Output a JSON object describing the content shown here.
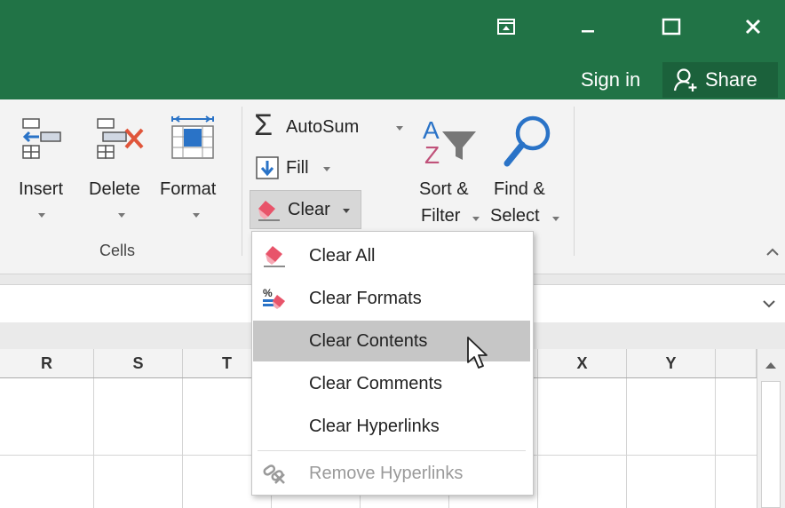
{
  "title_bar": {
    "window_buttons": [
      "ribbon-display-options",
      "minimize",
      "maximize",
      "close"
    ],
    "sign_in": "Sign in",
    "share": "Share"
  },
  "ribbon": {
    "cells_group": {
      "label": "Cells",
      "insert": "Insert",
      "delete": "Delete",
      "format": "Format"
    },
    "editing_group": {
      "autosum": "AutoSum",
      "fill": "Fill",
      "clear": "Clear",
      "sort_filter_1": "Sort &",
      "sort_filter_2": "Filter",
      "find_select_1": "Find &",
      "find_select_2": "Select"
    }
  },
  "columns": [
    "R",
    "S",
    "T",
    "",
    "",
    "",
    "X",
    "Y"
  ],
  "clear_menu": {
    "items": [
      {
        "label": "Clear All",
        "icon": "eraser-icon",
        "state": "normal"
      },
      {
        "label": "Clear Formats",
        "icon": "clear-formats-icon",
        "state": "normal"
      },
      {
        "label": "Clear Contents",
        "icon": "",
        "state": "hover"
      },
      {
        "label": "Clear Comments",
        "icon": "",
        "state": "normal"
      },
      {
        "label": "Clear Hyperlinks",
        "icon": "",
        "state": "normal"
      },
      {
        "label": "Remove Hyperlinks",
        "icon": "remove-hyperlinks-icon",
        "state": "disabled"
      }
    ]
  },
  "colors": {
    "title_bar": "#217346",
    "share_button": "#1b613b",
    "menu_hover": "#c6c6c6",
    "eraser_pink": "#e8546a"
  }
}
